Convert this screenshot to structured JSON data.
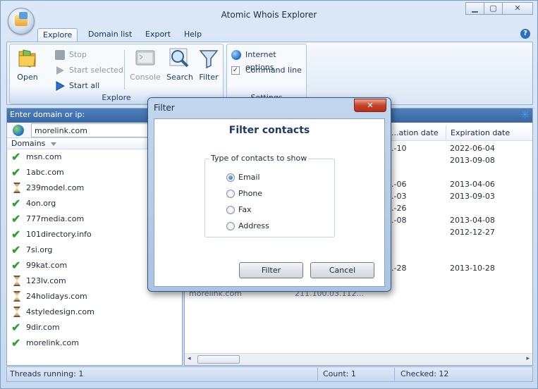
{
  "app": {
    "title": "Atomic Whois Explorer",
    "window_buttons": {
      "minimize": "▁",
      "maximize": "▢",
      "close": "✕"
    }
  },
  "menu": {
    "tabs": [
      {
        "label": "Explore",
        "active": true
      },
      {
        "label": "Domain list",
        "active": false
      },
      {
        "label": "Export",
        "active": false
      },
      {
        "label": "Help",
        "active": false
      }
    ],
    "help_icon": "?"
  },
  "ribbon": {
    "explore_group": {
      "label": "Explore",
      "open": "Open",
      "stop": "Stop",
      "start_selected": "Start selected",
      "start_all": "Start all",
      "console": "Console",
      "search": "Search",
      "filter": "Filter"
    },
    "settings_group": {
      "label": "Settings",
      "internet_options": "Internet options",
      "command_line": "Command line",
      "command_line_checked": true
    }
  },
  "left_panel": {
    "header": "Enter domain or ip:",
    "domain_value": "morelink.com",
    "column_header": "Domains",
    "domains": [
      {
        "name": "msn.com",
        "status": "done"
      },
      {
        "name": "1abc.com",
        "status": "done"
      },
      {
        "name": "239model.com",
        "status": "pending"
      },
      {
        "name": "4on.org",
        "status": "done"
      },
      {
        "name": "777media.com",
        "status": "done"
      },
      {
        "name": "101directory.info",
        "status": "done"
      },
      {
        "name": "7si.org",
        "status": "done"
      },
      {
        "name": "99kat.com",
        "status": "done"
      },
      {
        "name": "123lv.com",
        "status": "pending"
      },
      {
        "name": "24holidays.com",
        "status": "pending"
      },
      {
        "name": "4styledesign.com",
        "status": "pending"
      },
      {
        "name": "9dir.com",
        "status": "done"
      },
      {
        "name": "morelink.com",
        "status": "done"
      }
    ]
  },
  "right_panel": {
    "columns": [
      "...ation date",
      "Expiration date"
    ],
    "rows": [
      {
        "creation": "...-10",
        "expiration": "2022-06-04"
      },
      {
        "creation": "",
        "expiration": "2013-09-08"
      },
      {
        "creation": "",
        "expiration": ""
      },
      {
        "creation": "...-06",
        "expiration": "2013-04-06"
      },
      {
        "creation": "...-03",
        "expiration": "2013-09-03"
      },
      {
        "creation": "...-26",
        "expiration": ""
      },
      {
        "creation": "...-08",
        "expiration": "2013-04-08"
      },
      {
        "creation": "",
        "expiration": "2012-12-27"
      },
      {
        "creation": "",
        "expiration": ""
      },
      {
        "creation": "",
        "expiration": ""
      },
      {
        "creation": "...-28",
        "expiration": "2013-10-28"
      }
    ],
    "partial_row": {
      "domain": "morelink.com",
      "ip": "211.100.03.112..."
    }
  },
  "statusbar": {
    "threads": "Threads running: 1",
    "count": "Count: 1",
    "checked": "Checked: 12"
  },
  "dialog": {
    "title": "Filter",
    "close": "✕",
    "heading": "Filter contacts",
    "group_label": "Type of contacts to show",
    "options": [
      {
        "label": "Email",
        "selected": true
      },
      {
        "label": "Phone",
        "selected": false
      },
      {
        "label": "Fax",
        "selected": false
      },
      {
        "label": "Address",
        "selected": false
      }
    ],
    "filter_button": "Filter",
    "cancel_button": "Cancel"
  }
}
